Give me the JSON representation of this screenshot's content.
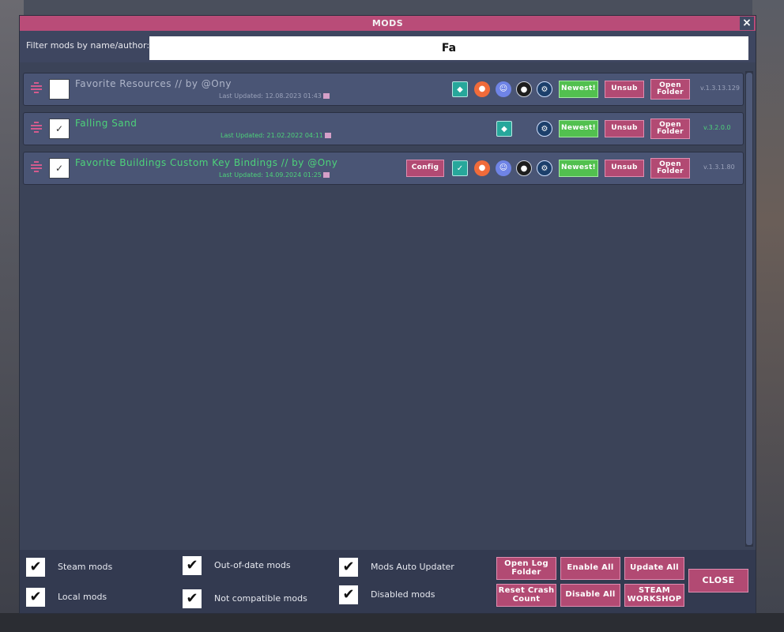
{
  "window": {
    "title": "MODS",
    "close_glyph": "×"
  },
  "filter": {
    "label": "Filter mods by name/author:",
    "value": "Fa"
  },
  "mods": [
    {
      "title": "Favorite Resources // by @Ony",
      "updated": "Last Updated: 12.08.2023 01:43",
      "enabled": false,
      "config_label": "",
      "newest_label": "Newest!",
      "unsub_label": "Unsub",
      "open_folder_label": "Open Folder",
      "version": "v.1.3.13.129"
    },
    {
      "title": "Falling Sand",
      "updated": "Last Updated: 21.02.2022 04:11",
      "enabled": true,
      "newest_label": "Newest!",
      "unsub_label": "Unsub",
      "open_folder_label": "Open Folder",
      "version": "v.3.2.0.0"
    },
    {
      "title": "Favorite Buildings  Custom Key Bindings // by @Ony",
      "updated": "Last Updated: 14.09.2024 01:25",
      "enabled": true,
      "config_label": "Config",
      "newest_label": "Newest!",
      "unsub_label": "Unsub",
      "open_folder_label": "Open Folder",
      "version": "v.1.3.1.80"
    }
  ],
  "footer": {
    "options": [
      {
        "label": "Steam mods",
        "checked": true
      },
      {
        "label": "Local mods",
        "checked": true
      },
      {
        "label": "Out-of-date mods",
        "checked": true
      },
      {
        "label": "Not compatible mods",
        "checked": true
      },
      {
        "label": "Mods Auto Updater",
        "checked": true
      },
      {
        "label": "Disabled mods",
        "checked": true
      }
    ],
    "check_glyph": "✔",
    "buttons": {
      "open_log": "Open Log Folder",
      "enable_all": "Enable All",
      "update_all": "Update All",
      "reset_crash": "Reset Crash Count",
      "disable_all": "Disable All",
      "steam_workshop": "STEAM WORKSHOP",
      "close": "CLOSE"
    }
  },
  "icons": {
    "teal": "mod-tag-icon",
    "orange": "patreon-icon",
    "discord": "discord-icon",
    "github": "github-icon",
    "steam": "steam-icon"
  },
  "colors": {
    "title_bar": "#b94c78",
    "enabled_text": "#4dd27a",
    "green_button": "#52c04f",
    "pink_button": "#b24a73",
    "panel": "#3b4358"
  }
}
